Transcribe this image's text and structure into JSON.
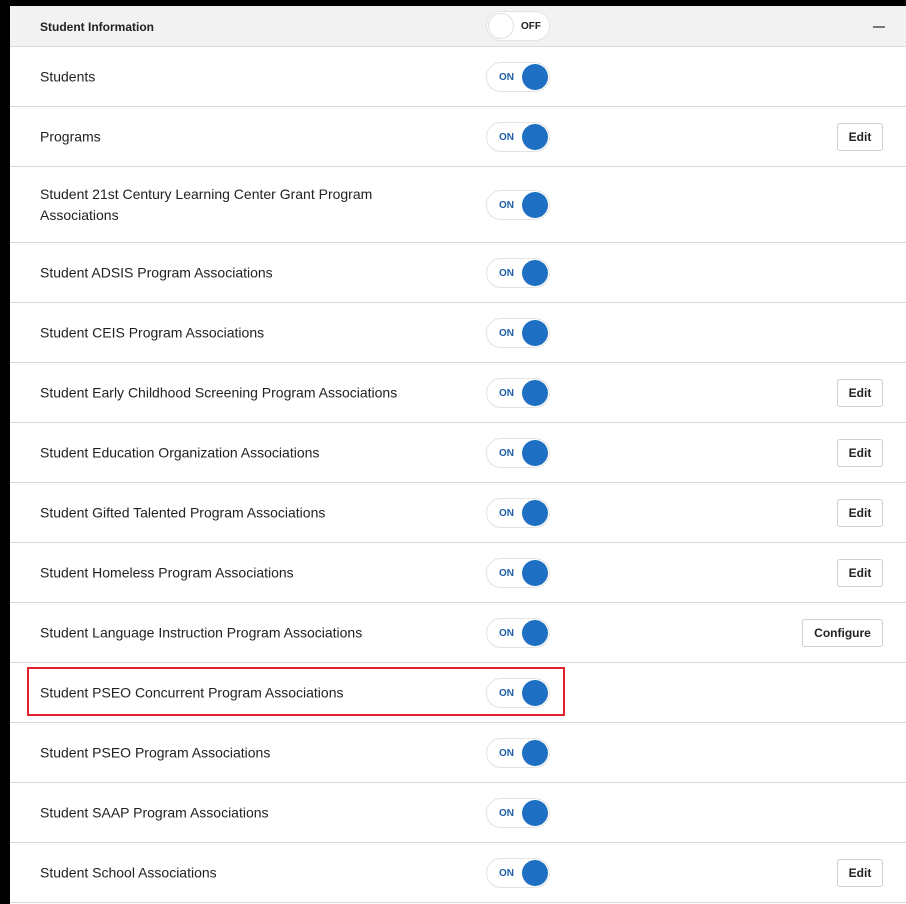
{
  "header": {
    "title": "Student Information",
    "toggle_state": "OFF",
    "collapse_icon": "minus-icon"
  },
  "rows": [
    {
      "label": "Students",
      "toggle": "ON",
      "action": ""
    },
    {
      "label": "Programs",
      "toggle": "ON",
      "action": "Edit"
    },
    {
      "label": "Student 21st Century Learning Center Grant Program Associations",
      "toggle": "ON",
      "action": ""
    },
    {
      "label": "Student ADSIS Program Associations",
      "toggle": "ON",
      "action": ""
    },
    {
      "label": "Student CEIS Program Associations",
      "toggle": "ON",
      "action": ""
    },
    {
      "label": "Student Early Childhood Screening Program Associations",
      "toggle": "ON",
      "action": "Edit"
    },
    {
      "label": "Student Education Organization Associations",
      "toggle": "ON",
      "action": "Edit"
    },
    {
      "label": "Student Gifted Talented Program Associations",
      "toggle": "ON",
      "action": "Edit"
    },
    {
      "label": "Student Homeless Program Associations",
      "toggle": "ON",
      "action": "Edit"
    },
    {
      "label": "Student Language Instruction Program Associations",
      "toggle": "ON",
      "action": "Configure"
    },
    {
      "label": "Student PSEO Concurrent Program Associations",
      "toggle": "ON",
      "action": ""
    },
    {
      "label": "Student PSEO Program Associations",
      "toggle": "ON",
      "action": ""
    },
    {
      "label": "Student SAAP Program Associations",
      "toggle": "ON",
      "action": ""
    },
    {
      "label": "Student School Associations",
      "toggle": "ON",
      "action": "Edit"
    }
  ],
  "colors": {
    "toggle_on": "#1f6fc4",
    "highlight": "#e0202a",
    "header_bg": "#f2f2f2"
  }
}
